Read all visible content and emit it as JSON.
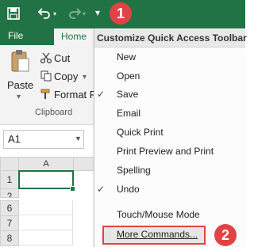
{
  "ribbon": {
    "tabs": [
      {
        "label": "File"
      },
      {
        "label": "Home"
      }
    ],
    "clipboard": {
      "paste_label": "Paste",
      "cut_label": "Cut",
      "copy_label": "Copy",
      "format_painter_label": "Format P",
      "group_label": "Clipboard"
    }
  },
  "namebox": {
    "value": "A1"
  },
  "sheet": {
    "column_headers": [
      "A"
    ],
    "row_headers": [
      "1",
      "2",
      "6",
      "7",
      "8"
    ]
  },
  "menu": {
    "title": "Customize Quick Access Toolbar",
    "items": [
      {
        "label": "New",
        "checked": ""
      },
      {
        "label": "Open",
        "checked": ""
      },
      {
        "label": "Save",
        "checked": "✓"
      },
      {
        "label": "Email",
        "checked": ""
      },
      {
        "label": "Quick Print",
        "checked": ""
      },
      {
        "label": "Print Preview and Print",
        "checked": ""
      },
      {
        "label": "Spelling",
        "checked": ""
      },
      {
        "label": "Undo",
        "checked": "✓"
      },
      {
        "label": "Touch/Mouse Mode",
        "checked": ""
      },
      {
        "label": "More Commands...",
        "checked": ""
      }
    ]
  },
  "annotations": {
    "step1": "1",
    "step2": "2"
  },
  "colors": {
    "excel_green": "#217346",
    "badge_red": "#e04343"
  }
}
